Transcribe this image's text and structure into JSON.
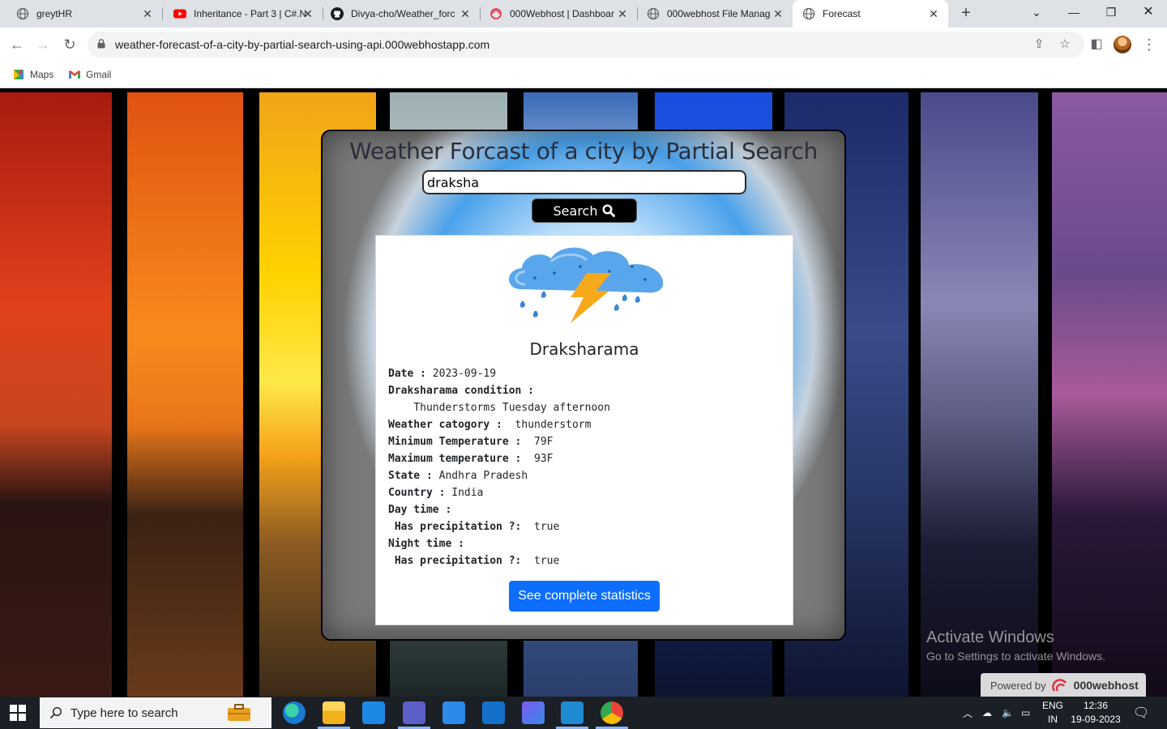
{
  "browser": {
    "tabs": [
      {
        "title": "greytHR"
      },
      {
        "title": "Inheritance - Part 3 | C#.N"
      },
      {
        "title": "Divya-cho/Weather_forc"
      },
      {
        "title": "000Webhost | Dashboar"
      },
      {
        "title": "000webhost File Manag"
      },
      {
        "title": "Forecast"
      }
    ],
    "url": "weather-forecast-of-a-city-by-partial-search-using-api.000webhostapp.com",
    "bookmarks": [
      {
        "label": "Maps"
      },
      {
        "label": "Gmail"
      }
    ]
  },
  "page": {
    "title": "Weather Forcast of a city by Partial Search",
    "search": {
      "value": "draksha",
      "button_label": "Search"
    },
    "card": {
      "city": "Draksharama",
      "weather_icon": "thunderstorm-cloud-icon",
      "rows": [
        {
          "label": "Date : ",
          "value": "2023-09-19"
        },
        {
          "label": "Draksharama condition :",
          "value": ""
        },
        {
          "label": "    ",
          "value": "Thunderstorms Tuesday afternoon"
        },
        {
          "label": "Weather catogory : ",
          "value": " thunderstorm"
        },
        {
          "label": "Minimum Temperature : ",
          "value": " 79F"
        },
        {
          "label": "Maximum temperature : ",
          "value": " 93F"
        },
        {
          "label": "State : ",
          "value": "Andhra Pradesh"
        },
        {
          "label": "Country : ",
          "value": "India"
        },
        {
          "label": "Day time :",
          "value": ""
        },
        {
          "label": " Has precipitation ?: ",
          "value": " true"
        },
        {
          "label": "Night time :",
          "value": ""
        },
        {
          "label": " Has precipitation ?: ",
          "value": " true"
        }
      ],
      "stats_button": "See complete statistics"
    }
  },
  "overlay": {
    "activate_title": "Activate Windows",
    "activate_sub": "Go to Settings to activate Windows.",
    "powered_by": "Powered by",
    "powered_brand": "000webhost"
  },
  "taskbar": {
    "search_placeholder": "Type here to search",
    "lang": "ENG",
    "region": "IN",
    "time": "12:36",
    "date": "19-09-2023"
  }
}
